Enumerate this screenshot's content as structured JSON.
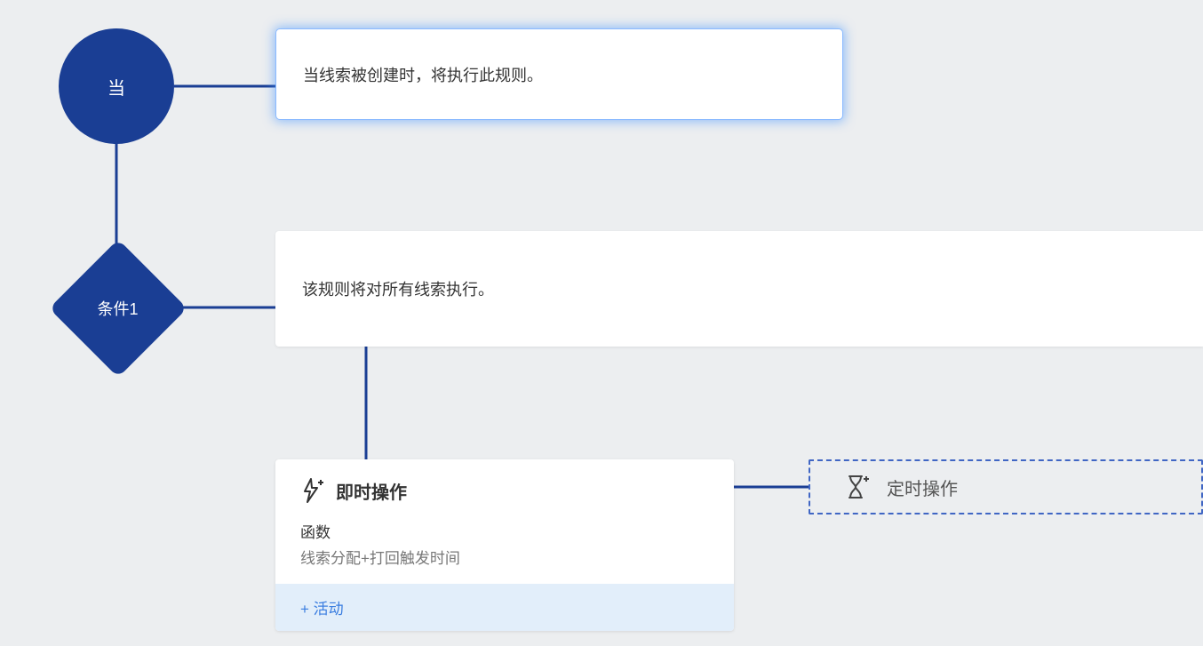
{
  "trigger": {
    "node_label": "当",
    "description": "当线索被创建时，将执行此规则。"
  },
  "condition": {
    "node_label": "条件1",
    "description": "该规则将对所有线索执行。"
  },
  "instant_action": {
    "title": "即时操作",
    "section_label": "函数",
    "function_name": "线索分配+打回触发时间",
    "add_activity_label": "+ 活动"
  },
  "scheduled_action": {
    "title": "定时操作"
  }
}
